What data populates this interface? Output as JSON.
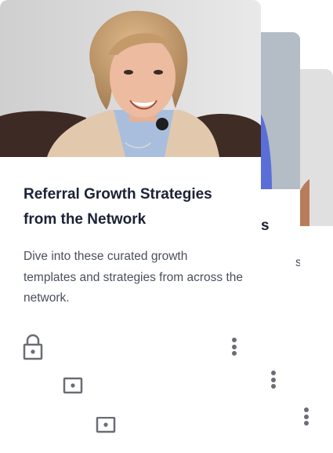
{
  "cards": [
    {
      "title": "Referral Growth Strategies from the Network",
      "description": "Dive into these curated growth templates and strategies from across the network.",
      "locked": true
    },
    {
      "title_fragment": "s",
      "description_fragment": "s",
      "locked": true
    },
    {
      "locked": true
    }
  ],
  "colors": {
    "title": "#1b2236",
    "description": "#4a4f5c",
    "icon": "#6a6d75",
    "background": "#ffffff"
  },
  "icons": [
    "lock-icon",
    "more-vertical-icon"
  ]
}
